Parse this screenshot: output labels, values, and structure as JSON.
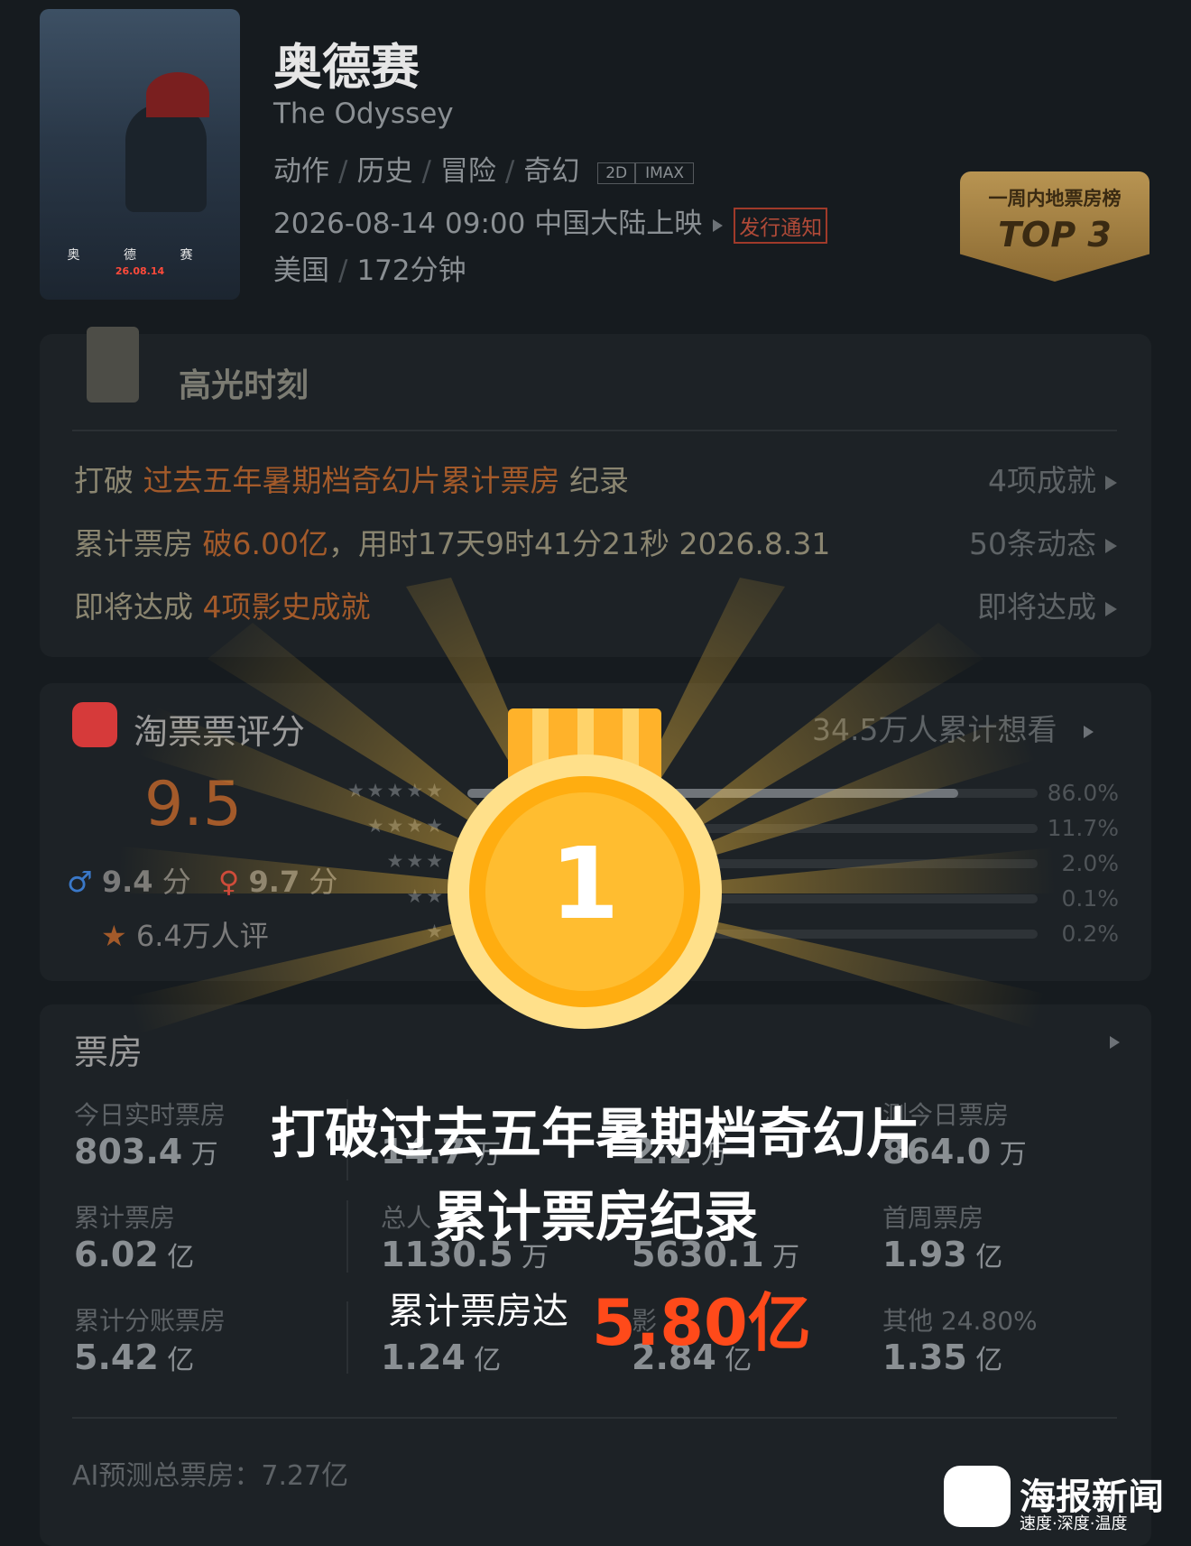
{
  "movie": {
    "poster_title": "奥 德 赛",
    "poster_date": "26.08.14",
    "title": "奥德赛",
    "english_title": "The Odyssey",
    "genres": [
      "动作",
      "历史",
      "冒险",
      "奇幻"
    ],
    "format_2d": "2D",
    "format_imax": "IMAX",
    "release": "2026-08-14 09:00 中国大陆上映",
    "release_notice": "发行通知",
    "country": "美国",
    "duration": "172分钟"
  },
  "rank_badge": {
    "title": "一周内地票房榜",
    "rank": "TOP 3"
  },
  "highlights": {
    "title": "高光时刻",
    "rows": [
      {
        "prefix": "打破 ",
        "hot": "过去五年暑期档奇幻片累计票房",
        "suffix": " 纪录",
        "link": "4项成就"
      },
      {
        "prefix": "累计票房 ",
        "hot": "破6.00亿",
        "suffix": "，用时17天9时41分21秒 2026.8.31",
        "link": "50条动态"
      },
      {
        "prefix": "即将达成 ",
        "hot": "4项影史成就",
        "suffix": "",
        "link": "即将达成"
      }
    ]
  },
  "rating": {
    "title": "淘票票评分",
    "want": "34.5万人累计想看",
    "score": "9.5",
    "male": "9.4",
    "female": "9.7",
    "unit": "分",
    "count": "6.4万人评",
    "distribution": [
      {
        "stars": "★★★★★",
        "pct": "86.0%",
        "value": 0.86
      },
      {
        "stars": "★★★★",
        "pct": "11.7%",
        "value": 0.117
      },
      {
        "stars": "★★★",
        "pct": "2.0%",
        "value": 0.02
      },
      {
        "stars": "★★",
        "pct": "0.1%",
        "value": 0.001
      },
      {
        "stars": "★",
        "pct": "0.2%",
        "value": 0.002
      }
    ]
  },
  "box_office": {
    "title": "票房",
    "cells": [
      {
        "label": "今日实时票房",
        "value": "803.4",
        "unit": "万"
      },
      {
        "label": "",
        "value": "14.7",
        "unit": "万"
      },
      {
        "label": "",
        "value": "2.2",
        "unit": "万"
      },
      {
        "label": "测今日票房",
        "value": "864.0",
        "unit": "万"
      },
      {
        "label": "累计票房",
        "value": "6.02",
        "unit": "亿"
      },
      {
        "label": "总人",
        "value": "1130.5",
        "unit": "万"
      },
      {
        "label": "",
        "value": "5630.1",
        "unit": "万"
      },
      {
        "label": "首周票房",
        "value": "1.93",
        "unit": "亿"
      },
      {
        "label": "累计分账票房",
        "value": "5.42",
        "unit": "亿"
      },
      {
        "label": "",
        "value": "1.24",
        "unit": "亿"
      },
      {
        "label": "影",
        "value": "2.84",
        "unit": "亿"
      },
      {
        "label": "其他 24.80%",
        "value": "1.35",
        "unit": "亿"
      }
    ],
    "ai_forecast": "AI预测总票房：7.27亿"
  },
  "overlay": {
    "medal_number": "1",
    "line1": "打破过去五年暑期档奇幻片",
    "line2": "累计票房纪录",
    "line3": "累计票房达",
    "big_value": "5.80亿"
  },
  "watermark": {
    "title": "海报新闻",
    "sub": "速度·深度·温度"
  },
  "colors": {
    "accent_orange": "#a35a2a",
    "medal_gold": "#ffb020",
    "overlay_red": "#ff4a1a"
  }
}
